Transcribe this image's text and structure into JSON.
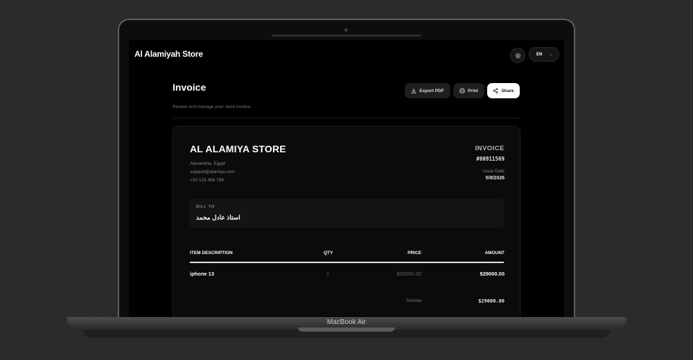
{
  "app": {
    "brand": "Al Alamiyah Store",
    "language": "EN"
  },
  "page": {
    "title": "Invoice",
    "subtitle": "Review and manage your store invoice.",
    "actions": {
      "export": "Export PDF",
      "print": "Print",
      "share": "Share"
    }
  },
  "invoice": {
    "store_name": "AL ALAMIYA STORE",
    "address": "Alexandria, Egypt",
    "email": "support@alamiya.com",
    "phone": "+20 123 456 789",
    "label": "INVOICE",
    "number": "#80911569",
    "issue_date_label": "Issue Date",
    "issue_date": "5/9/2026",
    "bill_to_label": "BILL TO",
    "bill_to_name": "استاذ عادل محمد",
    "columns": {
      "description": "ITEM DESCRIPTION",
      "qty": "QTY",
      "price": "PRICE",
      "amount": "AMOUNT"
    },
    "items": [
      {
        "description": "iphone 13",
        "qty": "1",
        "price": "$29000.00",
        "amount": "$29000.00"
      }
    ],
    "subtotal_label": "Subtotal",
    "subtotal": "$29000.00"
  },
  "device": {
    "label": "MacBook Air"
  },
  "colors": {
    "background": "#2b2b2b",
    "screen": "#000000",
    "card": "#0b0b0b",
    "primary_button": "#ffffff"
  }
}
